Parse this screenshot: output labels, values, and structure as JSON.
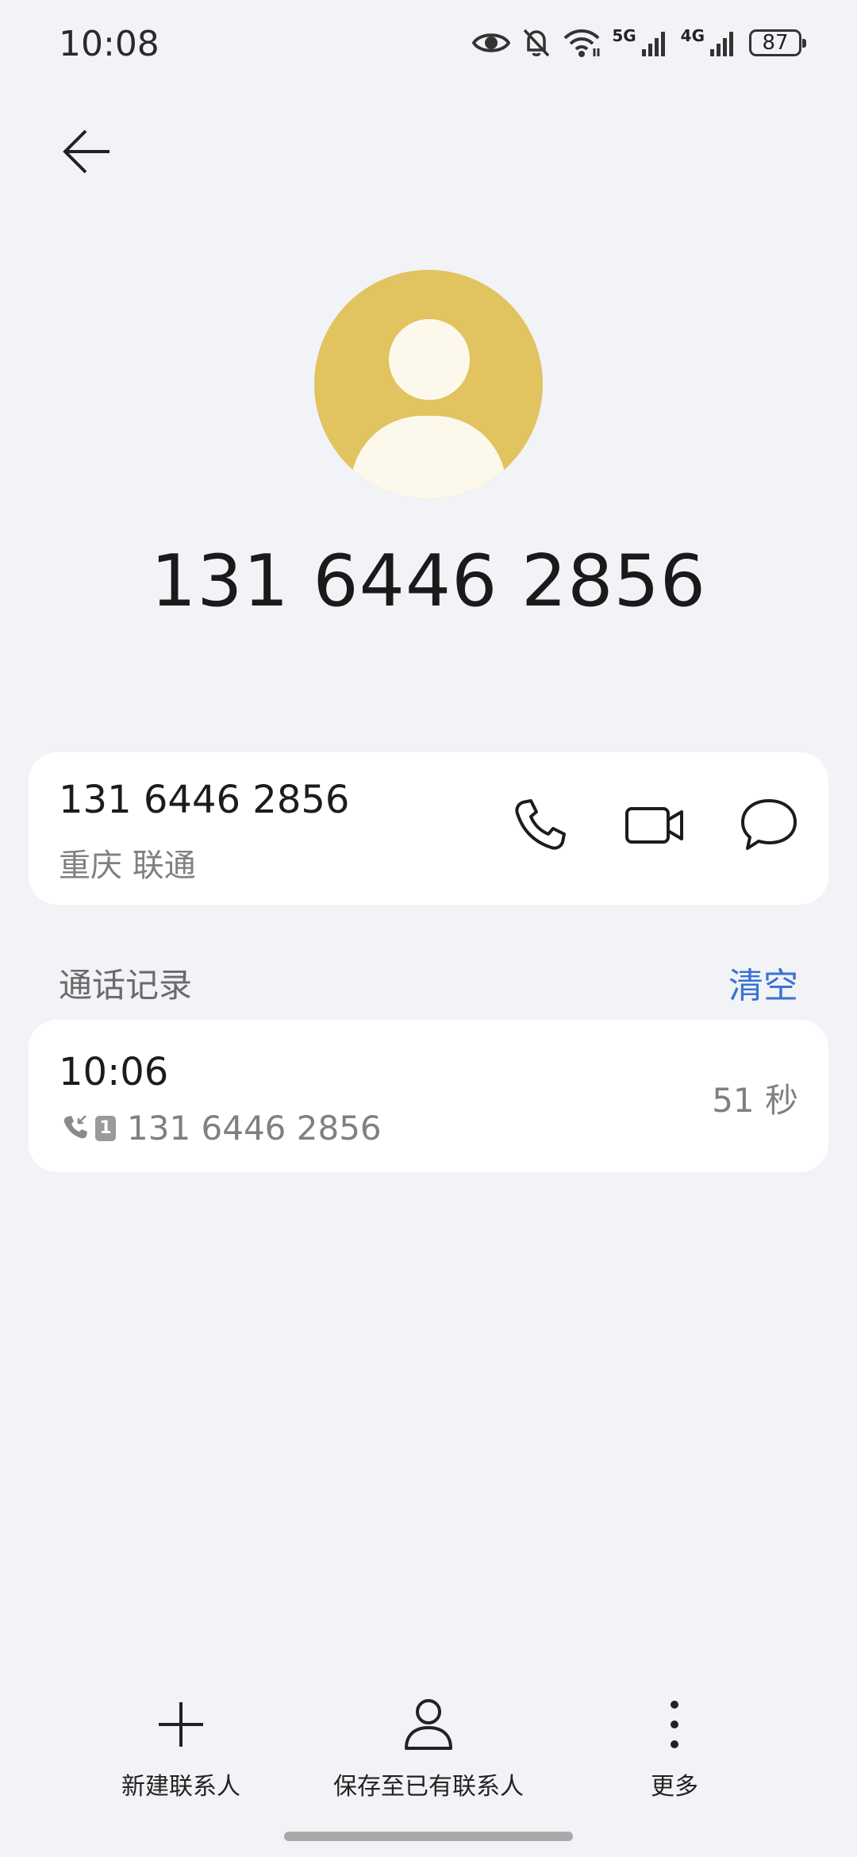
{
  "status_bar": {
    "time": "10:08",
    "network_1": "5G",
    "network_2": "4G",
    "battery_level": "87",
    "icons": [
      "eye-icon",
      "bell-off-icon",
      "wifi-icon",
      "signal-icon",
      "signal-icon",
      "battery-icon"
    ]
  },
  "header": {
    "back_icon": "arrow-left-icon"
  },
  "contact": {
    "avatar_icon": "person-avatar-icon",
    "avatar_color": "#e1c35f",
    "display_number": "131 6446 2856"
  },
  "number_card": {
    "number": "131 6446 2856",
    "location": "重庆 联通",
    "actions": [
      "phone-icon",
      "video-call-icon",
      "message-icon"
    ]
  },
  "call_log": {
    "title": "通话记录",
    "clear_label": "清空",
    "accent_color": "#3a72d6",
    "entries": [
      {
        "time": "10:06",
        "direction_icon": "incoming-call-icon",
        "sim": "1",
        "number": "131 6446 2856",
        "duration": "51 秒"
      }
    ]
  },
  "bottom_bar": {
    "new_contact": "新建联系人",
    "save_existing": "保存至已有联系人",
    "more": "更多"
  }
}
